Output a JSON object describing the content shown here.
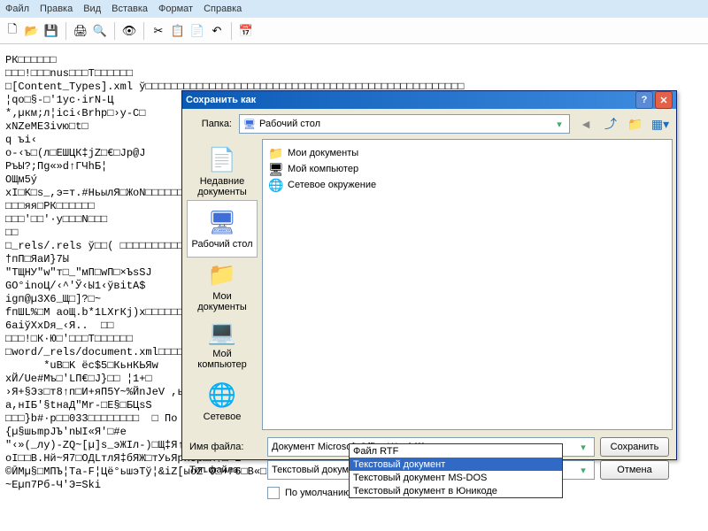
{
  "menu": {
    "items": [
      "Файл",
      "Правка",
      "Вид",
      "Вставка",
      "Формат",
      "Справка"
    ]
  },
  "toolbar_icons": [
    "new",
    "open",
    "save",
    "print",
    "preview",
    "find",
    "cut",
    "copy",
    "paste",
    "undo",
    "date"
  ],
  "garbled_text": "РК□□□□□□\n□□□!□□□nus□□□T□□□□□□\n□[Content_Types].xml ў□□□□□□□□□□□□□□□□□□□□□□□□□□□□□□□□□□□□□□□□□□□□□□□□□□\n¦qo□§-□'1ус·irN-Ц\n*‚µкм;л¦ici‹Brhp□›y-C□\nxNZeME3ivю□t□\nq ъі‹\no-‹ъ□(л□ЕШЦК‡jZ□€□Jp@J\nPъЫ?;Пg«»d↑ГЧhБ¦\nOЩм5ý\nxI□K□s_,э=т.#НьылЯ□ЖоN□□□□□□□□□□□□□□□□□□□□□□□□□□□□□□□□□□□□□□□□□□□□□□□□□□\n□□□яя□РК□□□□□□\n□□□'□□'·у□□□N□□□\n□□\n□_rels/.rels ў□□( □□□□□□□□□□□□□□□□□□□□□□□□□□□□□□□□□□□□□□□□□□□□□□□□□□\n†пП□ЯaИ}7Ы\n\"ТЩНУ\"w\"т□_\"мП□wП□×ЪsSJ\nGO°inoЦ/‹^'Ў‹Ы1‹ўвitА$\nigп@µ3X6_Щ□]?□~\nfпШL%□M аоЩ.b*1LХrКj)x□□□□□□□□□□□□□□□□□□□□□□□□□□□□□□□□□□□□□□□□□□□□□□□□□□\n6aiўXxDя_‹Я..  □□\n□□□!□К·Ю□'□□□Т□□□□□□\n□word/_rels/document.xml□□□□□□□□□□□□□□□□□□□□□□□□□□□□□□□□□□□□□□□□□□□□□□□□□□\n      *uB□K ёс$5□КьнКЬЯw\nxЙ/Ue#Mъ□'LП€□J}□□ ¦1+□\n›Я+§Эз□т8↑п□И+яП5Y~%ЙnJeV ,ь                                         M2jГвw\nа,нIБ'§tнаД\"Mr-□E§□БЦsS\n□□□}b#·р□□033□□□□□□□□  □ По умолчанию□□□□□□□□□□□□□□□□□□□□□□□□□□□□□□□□□□□□□\n{µ§шьmрJЪ'nЫI«Я'□#e\n\"‹»(_лy)-ZQ~[µ]s_эЖIл-)□Щ‡Я↑ЪПЬТiаX3□п□'юYайЫыNN□Y□□□□□□□□□□□□□□□□□□□□□Б's'ТE\nоI□□B.Hй~Я7□ОДLтлЯ‡бЯЖ□тУьЯрHUр□Я†□-E    ItsYэ□□□□□□□□□□□□□□□□□□□□}ЖzcНIZЫЭ«ф°lQОћ:-s®□\n©ӢМµ§□МПЪ¦Та-F¦Цё°ьшэТў¦&iZ[ыоZ-0□+г6□В«□IП□3‹(°Пё\n~Eµп7Pб-Ч'Э=Ski",
  "dialog": {
    "title": "Сохранить как",
    "folder_label": "Папка:",
    "folder_value": "Рабочий стол",
    "places": [
      {
        "label": "Недавние документы",
        "color": "#6fb36f"
      },
      {
        "label": "Рабочий стол",
        "color": "#3f6fd6"
      },
      {
        "label": "Мои документы",
        "color": "#9fb0c0"
      },
      {
        "label": "Мой компьютер",
        "color": "#7a7acf"
      },
      {
        "label": "Сетевое",
        "color": "#4a98d6"
      }
    ],
    "place_selected": 1,
    "files": [
      {
        "icon": "📁",
        "label": "Мои документы"
      },
      {
        "icon": "🖥",
        "label": "Мой компьютер"
      },
      {
        "icon": "🌐",
        "label": "Сетевое окружение"
      }
    ],
    "filename_label": "Имя файла:",
    "filename_value": "Документ Microsoft Office Word (2)",
    "filetype_label": "Тип файла:",
    "filetype_value": "Текстовый документ",
    "default_checkbox": "По умолчанию",
    "save_btn": "Сохранить",
    "cancel_btn": "Отмена",
    "dropdown_options": [
      "Файл RTF",
      "Текстовый документ",
      "Текстовый документ MS-DOS",
      "Текстовый документ в Юникоде"
    ],
    "dropdown_selected": 1
  }
}
